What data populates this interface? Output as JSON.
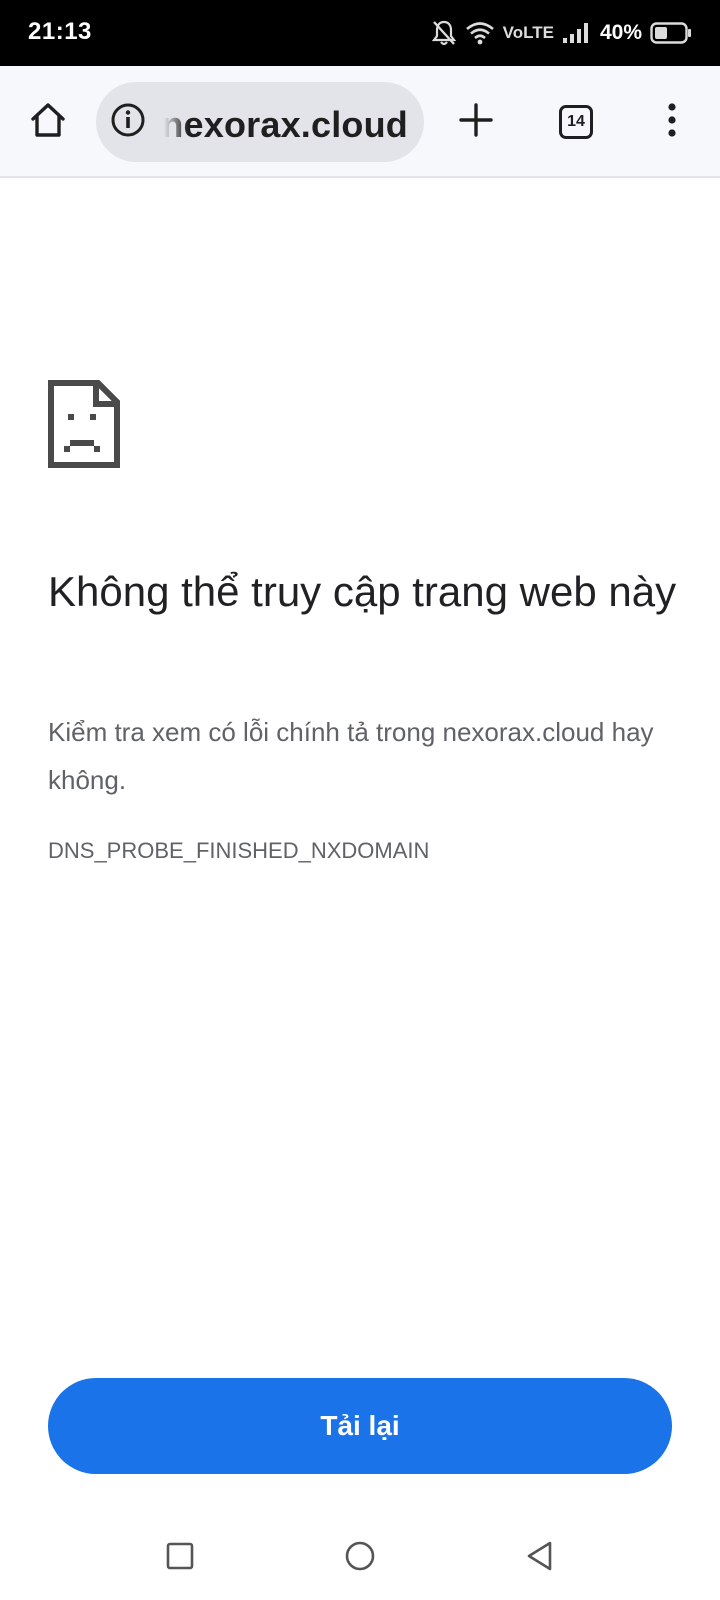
{
  "status_bar": {
    "time": "21:13",
    "network_label": "VoLTE",
    "battery_percent": "40%",
    "icons": [
      "mute-bell-icon",
      "wifi-icon",
      "signal-icon",
      "battery-icon"
    ]
  },
  "toolbar": {
    "url": "nexorax.cloud",
    "tab_count": "14",
    "icons": [
      "home-icon",
      "info-icon",
      "plus-icon",
      "tabs-icon",
      "more-vert-icon"
    ]
  },
  "error": {
    "title": "Không thể truy cập trang web này",
    "description": "Kiểm tra xem có lỗi chính tả trong nexorax.cloud hay không.",
    "code": "DNS_PROBE_FINISHED_NXDOMAIN",
    "icon": "sad-page-icon"
  },
  "actions": {
    "reload_label": "Tải lại"
  },
  "colors": {
    "accent": "#1a73e8",
    "title": "#202124",
    "secondary_text": "#5f6368",
    "toolbar_bg": "#f7f8fc",
    "omnibox_bg": "#e3e4ea"
  },
  "nav_bar": {
    "icons": [
      "recents-icon",
      "home-circle-icon",
      "back-icon"
    ]
  }
}
